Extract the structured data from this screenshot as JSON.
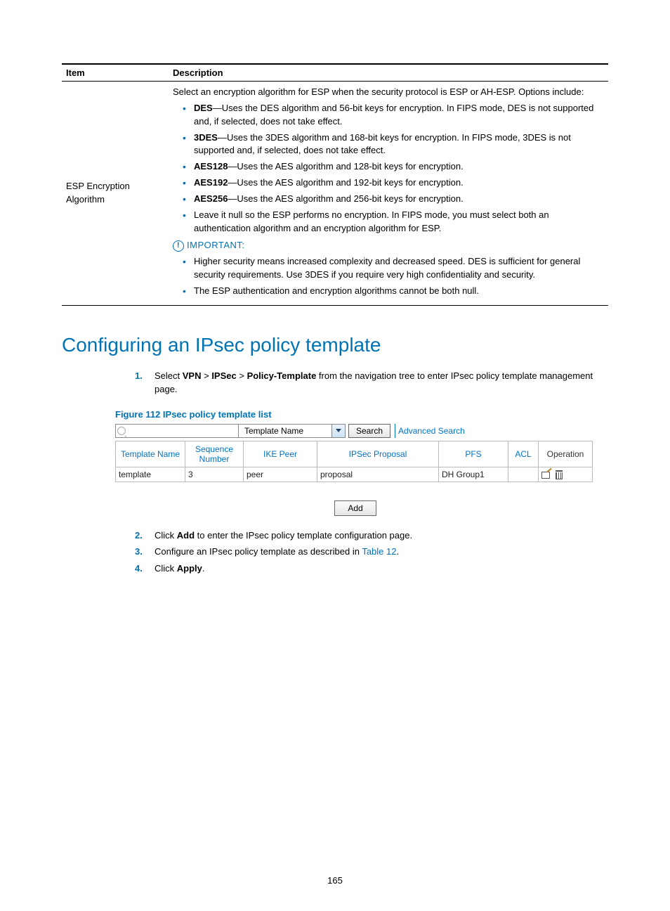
{
  "table": {
    "h_item": "Item",
    "h_desc": "Description",
    "row_item": "ESP Encryption Algorithm",
    "intro": "Select an encryption algorithm for ESP when the security protocol is ESP or AH-ESP. Options include:",
    "opts": [
      {
        "name": "DES",
        "text": "—Uses the DES algorithm and 56-bit keys for encryption. In FIPS mode, DES is not supported and, if selected, does not take effect."
      },
      {
        "name": "3DES",
        "text": "—Uses the 3DES algorithm and 168-bit keys for encryption. In FIPS mode, 3DES is not supported and, if selected, does not take effect."
      },
      {
        "name": "AES128",
        "text": "—Uses the AES algorithm and 128-bit keys for encryption."
      },
      {
        "name": "AES192",
        "text": "—Uses the AES algorithm and 192-bit keys for encryption."
      },
      {
        "name": "AES256",
        "text": "—Uses the AES algorithm and 256-bit keys for encryption."
      }
    ],
    "opt_null": "Leave it null so the ESP performs no encryption. In FIPS mode, you must select both an authentication algorithm and an encryption algorithm for ESP.",
    "important_label": "IMPORTANT:",
    "imp1": "Higher security means increased complexity and decreased speed. DES is sufficient for general security requirements. Use 3DES if you require very high confidentiality and security.",
    "imp2": "The ESP authentication and encryption algorithms cannot be both null."
  },
  "heading": "Configuring an IPsec policy template",
  "step1_a": "Select ",
  "step1_nav1": "VPN",
  "step1_sep": " > ",
  "step1_nav2": "IPSec",
  "step1_nav3": "Policy-Template",
  "step1_b": " from the navigation tree to enter IPsec policy template management page.",
  "figure_caption": "Figure 112 IPsec policy template list",
  "ui": {
    "dropdown": "Template Name",
    "search_btn": "Search",
    "adv": "Advanced Search",
    "cols": {
      "tname": "Template Name",
      "seq": "Sequence Number",
      "ike": "IKE Peer",
      "prop": "IPSec Proposal",
      "pfs": "PFS",
      "acl": "ACL",
      "op": "Operation"
    },
    "row": {
      "tname": "template",
      "seq": "3",
      "ike": "peer",
      "prop": "proposal",
      "pfs": "DH Group1",
      "acl": ""
    },
    "add_btn": "Add"
  },
  "step2_a": "Click ",
  "step2_b": "Add",
  "step2_c": " to enter the IPsec policy template configuration page.",
  "step3_a": "Configure an IPsec policy template as described in ",
  "step3_link": "Table 12",
  "step3_b": ".",
  "step4_a": "Click ",
  "step4_b": "Apply",
  "step4_c": ".",
  "pagenum": "165"
}
